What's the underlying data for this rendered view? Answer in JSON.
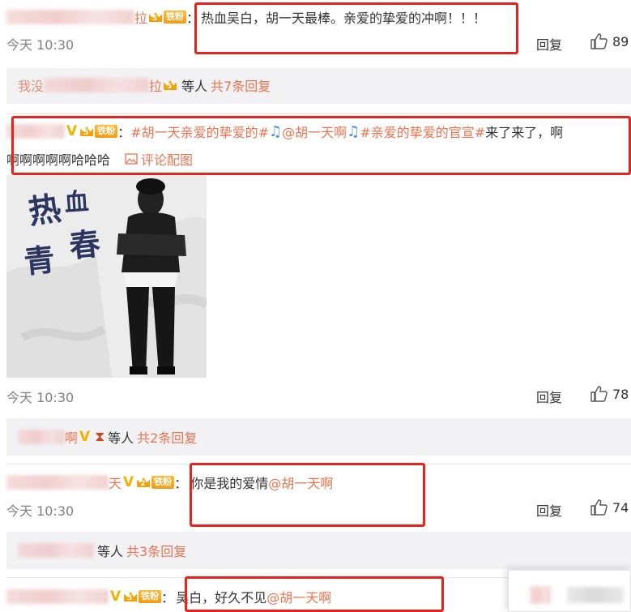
{
  "comment1": {
    "name_tail": "拉",
    "fan_level": "5",
    "fan_badge": "铁粉",
    "text": "热血吴白，胡一天最棒。亲爱的挚爱的冲啊！！！",
    "time": "今天 10:30",
    "reply_label": "回复",
    "likes": "89"
  },
  "thread1": {
    "name_head": "我没",
    "name_tail": "拉",
    "fan_level": "5",
    "etc": "等人",
    "count": "共7条回复"
  },
  "comment2": {
    "fan_level": "5",
    "fan_badge": "铁粉",
    "hashtag1": "#胡一天亲爱的挚爱的#",
    "mention": "@胡一天啊",
    "hashtag2": "#亲爱的挚爱的官宣#",
    "text_after": "来了来了，啊",
    "line2": "啊啊啊啊啊哈哈哈",
    "image_link": "评论配图",
    "poster_title": "热血青春",
    "time": "今天 10:30",
    "reply_label": "回复",
    "likes": "78"
  },
  "thread2": {
    "name_tail": "啊",
    "etc": "等人",
    "count": "共2条回复"
  },
  "comment3": {
    "name_tail": "天",
    "fan_level": "2",
    "fan_badge": "铁粉",
    "text": "你是我的爱情",
    "mention": "@胡一天啊",
    "time": "今天 10:30",
    "reply_label": "回复",
    "likes": "74"
  },
  "thread3": {
    "etc": "等人",
    "count": "共3条回复"
  },
  "comment4": {
    "fan_level": "5",
    "fan_badge": "铁粉",
    "text": "吴白，好久不见",
    "mention": "@胡一天啊"
  },
  "colors": {
    "link": "#eb7350",
    "highlight_box": "#e8231e",
    "reply_bar": "#f2f2f5",
    "verified": "#f5b000"
  }
}
